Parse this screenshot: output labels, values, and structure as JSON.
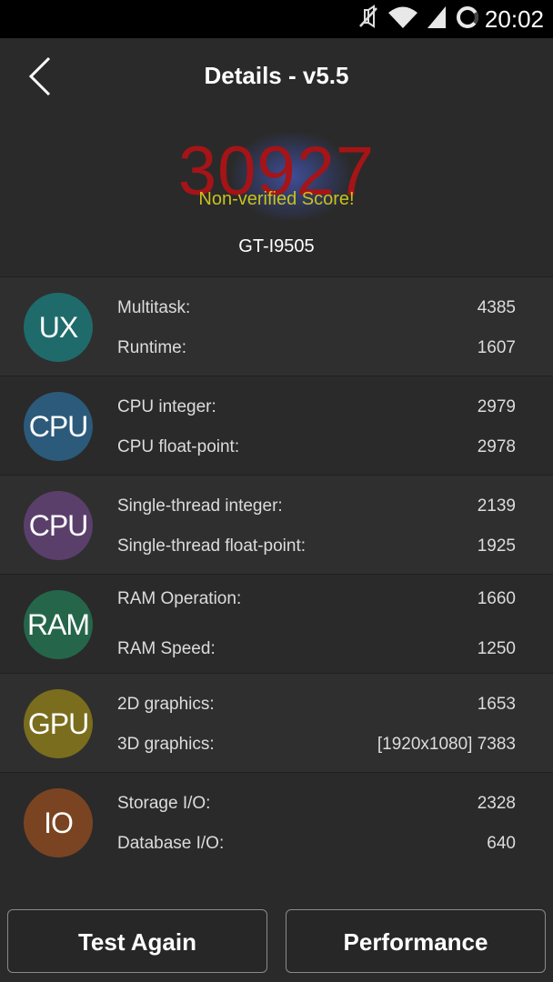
{
  "status_bar": {
    "time": "20:02",
    "icons": [
      "mute-icon",
      "wifi-icon",
      "signal-icon",
      "sync-icon"
    ]
  },
  "header": {
    "back_icon": "chevron-left-icon",
    "title": "Details - v5.5"
  },
  "score": {
    "value": "30927",
    "note": "Non-verified Score!",
    "device": "GT-I9505"
  },
  "colors": {
    "score": "#a51417",
    "note": "#c6c21c",
    "ux": "#1f6b6b",
    "cpu": "#2c5a7a",
    "cpu_single": "#5a3f6b",
    "ram": "#25664a",
    "gpu": "#7a6d1d",
    "io": "#7a4422"
  },
  "rows": [
    {
      "badge": "UX",
      "metrics": [
        {
          "label": "Multitask:",
          "value": "4385"
        },
        {
          "label": "Runtime:",
          "value": "1607"
        }
      ]
    },
    {
      "badge": "CPU",
      "metrics": [
        {
          "label": "CPU integer:",
          "value": "2979"
        },
        {
          "label": "CPU float-point:",
          "value": "2978"
        }
      ]
    },
    {
      "badge": "CPU",
      "metrics": [
        {
          "label": "Single-thread integer:",
          "value": "2139"
        },
        {
          "label": "Single-thread float-point:",
          "value": "1925"
        }
      ]
    },
    {
      "badge": "RAM",
      "metrics": [
        {
          "label": "RAM Operation:",
          "value": "1660"
        },
        {
          "label": "RAM Speed:",
          "value": "1250"
        }
      ]
    },
    {
      "badge": "GPU",
      "metrics": [
        {
          "label": "2D graphics:",
          "value": "1653"
        },
        {
          "label": "3D graphics:",
          "value": "[1920x1080] 7383"
        }
      ]
    },
    {
      "badge": "IO",
      "metrics": [
        {
          "label": "Storage I/O:",
          "value": "2328"
        },
        {
          "label": "Database I/O:",
          "value": "640"
        }
      ]
    }
  ],
  "buttons": {
    "test_again": "Test Again",
    "performance": "Performance"
  }
}
